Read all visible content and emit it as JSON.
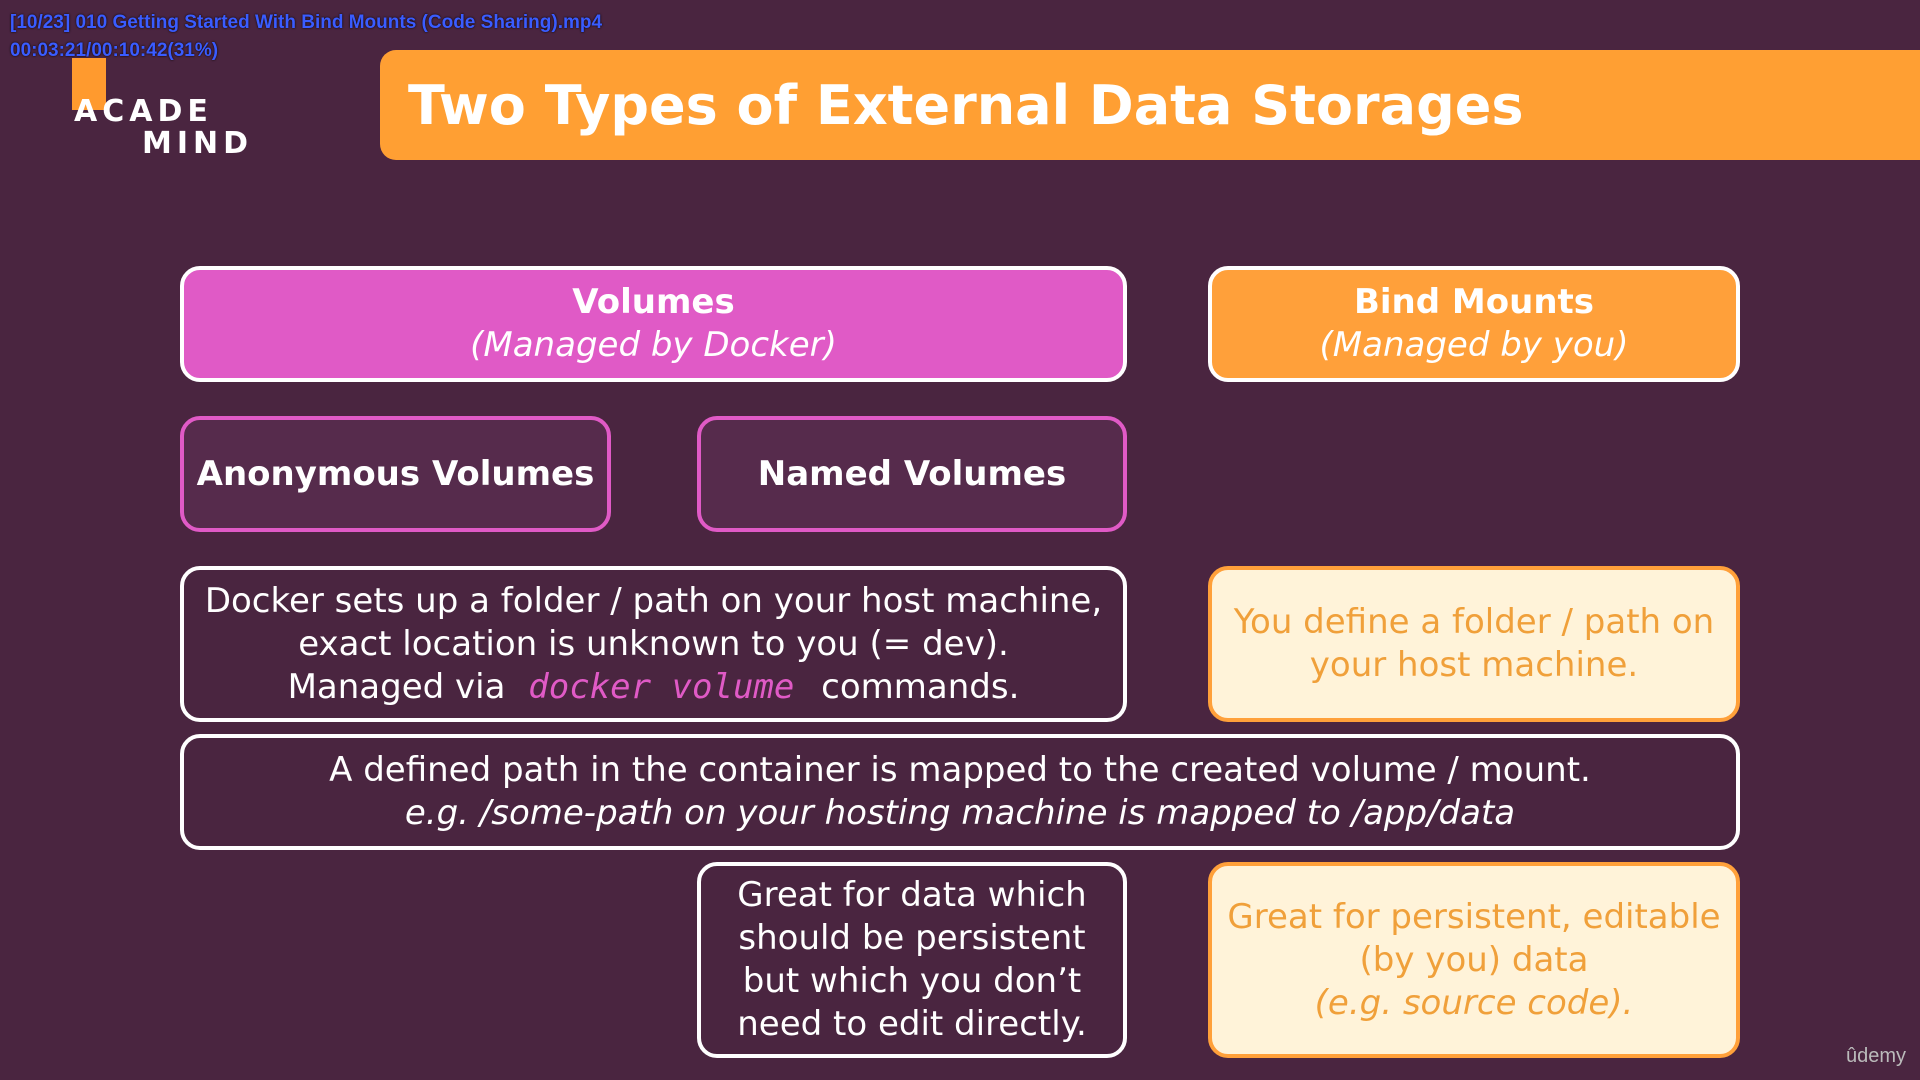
{
  "player": {
    "title": "[10/23] 010 Getting Started With Bind Mounts (Code Sharing).mp4",
    "time": "00:03:21/00:10:42(31%)"
  },
  "logo": {
    "line1": "ACADE",
    "line2": "MIND"
  },
  "slide": {
    "title": "Two Types of External Data Storages",
    "volumes": {
      "title": "Volumes",
      "subtitle": "(Managed by Docker)"
    },
    "bind_mounts": {
      "title": "Bind Mounts",
      "subtitle": "(Managed by you)"
    },
    "anonymous": "Anonymous Volumes",
    "named": "Named Volumes",
    "volumes_desc": {
      "line1": "Docker sets up a folder / path on your host machine,",
      "line2": "exact location is unknown to you (= dev).",
      "line3_pre": "Managed via",
      "line3_code": "docker volume",
      "line3_post": "commands."
    },
    "bind_desc": {
      "line1": "You define a folder / path on",
      "line2": "your host machine."
    },
    "shared": {
      "line1": "A defined path in the container is mapped to the created volume / mount.",
      "line2": "e.g. /some-path on your hosting machine is mapped to /app/data"
    },
    "volumes_use": {
      "line1": "Great for data which",
      "line2": "should be persistent",
      "line3": "but which you don’t",
      "line4": "need to edit directly."
    },
    "bind_use": {
      "line1": "Great for persistent, editable",
      "line2": "(by you) data",
      "line3": "(e.g. source code)."
    }
  },
  "watermark": "ûdemy",
  "colors": {
    "background": "#4a2540",
    "orange": "#ffa03a",
    "pink": "#e05ac6",
    "cream": "#fff3d9"
  }
}
